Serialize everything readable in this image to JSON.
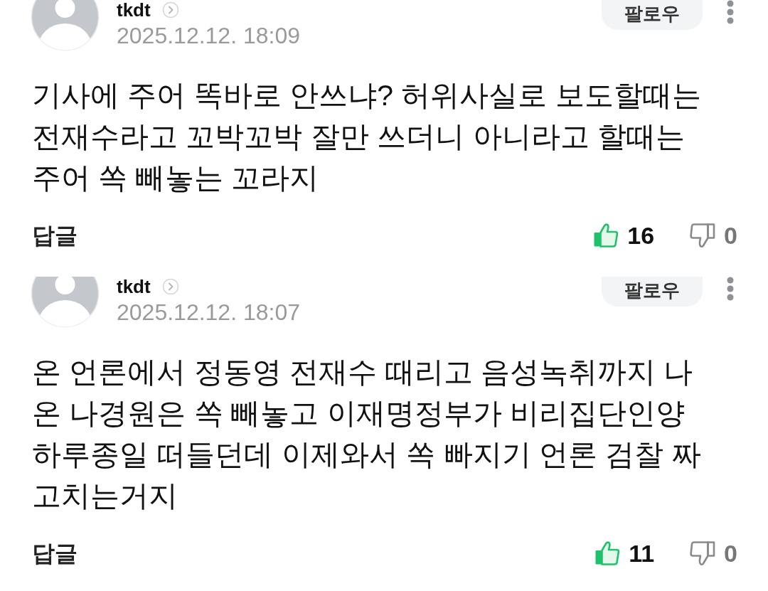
{
  "comments": [
    {
      "author": "tkdt",
      "follow_label": "팔로우",
      "date": "2025.12.12. 18:09",
      "text": "기사에 주어 똑바로 안쓰냐? 허위사실로 보도할때는 전재수라고 꼬박꼬박 잘만 쓰더니 아니라고 할때는 주어 쏙 빼놓는 꼬라지",
      "reply_label": "답글",
      "likes": "16",
      "dislikes": "0"
    },
    {
      "author": "tkdt",
      "follow_label": "팔로우",
      "date": "2025.12.12. 18:07",
      "text": "온 언론에서 정동영 전재수 때리고 음성녹취까지 나온 나경원은 쏙 빼놓고 이재명정부가 비리집단인양 하루종일 떠들던데 이제와서 쏙 빠지기 언론 검찰 짜고치는거지",
      "reply_label": "답글",
      "likes": "11",
      "dislikes": "0"
    }
  ]
}
